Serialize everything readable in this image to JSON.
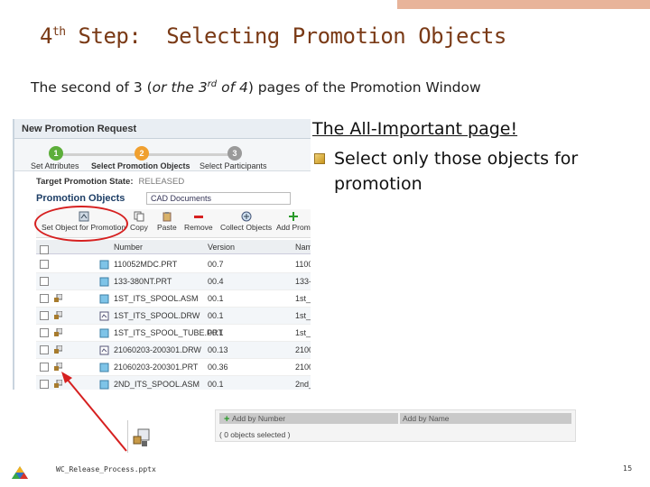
{
  "slide": {
    "title_prefix": "4",
    "title_sup": "th",
    "title_rest": " Step:  Selecting Promotion Objects",
    "subtitle_a": "The second of 3 (",
    "subtitle_italic_a": "or the 3",
    "subtitle_sup": "rd",
    "subtitle_italic_b": " of 4",
    "subtitle_b": ") pages of the Promotion Window",
    "bullet_main": "The All-Important page!",
    "bullet_sub": "Select only those objects for promotion",
    "footer_file": "WC_Release_Process.pptx",
    "page_number": "15",
    "accent_color": "#7a3a16",
    "annotation_color": "#d62020"
  },
  "window": {
    "title": "New Promotion Request",
    "steps": [
      {
        "num": "1",
        "label": "Set Attributes",
        "color": "#5cae3a"
      },
      {
        "num": "2",
        "label": "Select Promotion Objects",
        "color": "#f0a030"
      },
      {
        "num": "3",
        "label": "Select Participants",
        "color": "#9a9a9a"
      }
    ],
    "target_state_label": "Target Promotion State:",
    "target_state_value": "RELEASED",
    "objects_title": "Promotion Objects",
    "objects_filter": "CAD Documents",
    "toolbar": [
      {
        "label": "Set Object for Promotion",
        "icon": "set-object-icon"
      },
      {
        "label": "Copy",
        "icon": "copy-icon"
      },
      {
        "label": "Paste",
        "icon": "paste-icon"
      },
      {
        "label": "Remove",
        "icon": "remove-icon"
      },
      {
        "label": "Collect Objects",
        "icon": "collect-icon"
      },
      {
        "label": "Add Prom",
        "icon": "add-icon"
      }
    ],
    "columns": {
      "number": "Number",
      "version": "Version",
      "name": "Nam"
    },
    "rows": [
      {
        "number": "110052MDC.PRT",
        "version": "00.7",
        "name": "1100"
      },
      {
        "number": "133-380NT.PRT",
        "version": "00.4",
        "name": "133-"
      },
      {
        "number": "1ST_ITS_SPOOL.ASM",
        "version": "00.1",
        "name": "1st_l"
      },
      {
        "number": "1ST_ITS_SPOOL.DRW",
        "version": "00.1",
        "name": "1st_l"
      },
      {
        "number": "1ST_ITS_SPOOL_TUBE.PRT",
        "version": "00.1",
        "name": "1st_i"
      },
      {
        "number": "21060203-200301.DRW",
        "version": "00.13",
        "name": "2100"
      },
      {
        "number": "21060203-200301.PRT",
        "version": "00.36",
        "name": "2100"
      },
      {
        "number": "2ND_ITS_SPOOL.ASM",
        "version": "00.1",
        "name": "2nd_"
      }
    ]
  },
  "addbar": {
    "add_number": "Add by Number",
    "add_name": "Add by Name",
    "status": "( 0 objects selected )"
  }
}
